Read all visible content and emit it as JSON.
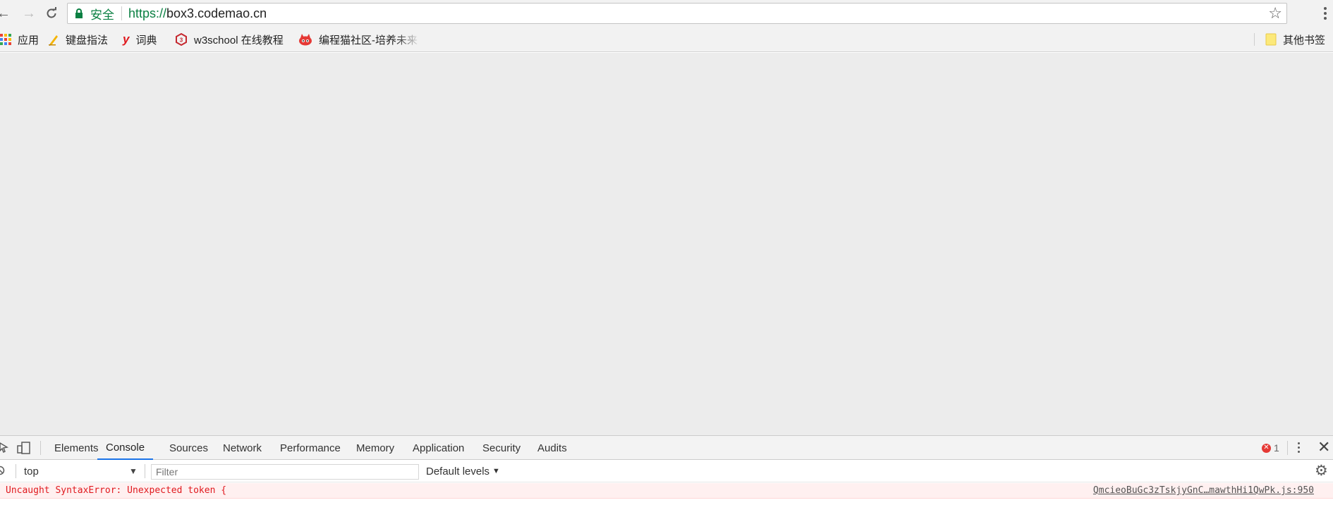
{
  "toolbar": {
    "back_icon": "arrow-left-icon",
    "forward_icon": "arrow-right-icon",
    "reload_icon": "reload-icon",
    "secure_label": "安全",
    "url_protocol": "https://",
    "url_host": "box3.codemao.cn",
    "star_icon": "star-icon",
    "menu_icon": "more-vert-icon"
  },
  "bookmarks": {
    "items": [
      {
        "label": "应用",
        "icon": "apps-grid-icon"
      },
      {
        "label": "键盘指法",
        "icon": "pencil-icon"
      },
      {
        "label": "词典",
        "icon": "youdao-icon"
      },
      {
        "label": "w3school 在线教程",
        "icon": "w3school-icon"
      },
      {
        "label": "编程猫社区-培养未来",
        "icon": "codemao-icon"
      }
    ],
    "other_label": "其他书签",
    "other_icon": "folder-icon"
  },
  "devtools": {
    "tabs": [
      "Elements",
      "Console",
      "Sources",
      "Network",
      "Performance",
      "Memory",
      "Application",
      "Security",
      "Audits"
    ],
    "active_tab": "Console",
    "error_count": "1",
    "context": "top",
    "filter_placeholder": "Filter",
    "levels_label": "Default levels",
    "console_messages": [
      {
        "level": "error",
        "text": "Uncaught SyntaxError: Unexpected token {",
        "source": "QmcieoBuGc3zTskjyGnC…mawthHi1QwPk.js:950"
      }
    ]
  },
  "colors": {
    "secure_green": "#0b8043",
    "page_bg": "#ececec",
    "error_red": "#e0191e",
    "error_bg": "#fff0f0",
    "active_tab_underline": "#1a73e8"
  }
}
